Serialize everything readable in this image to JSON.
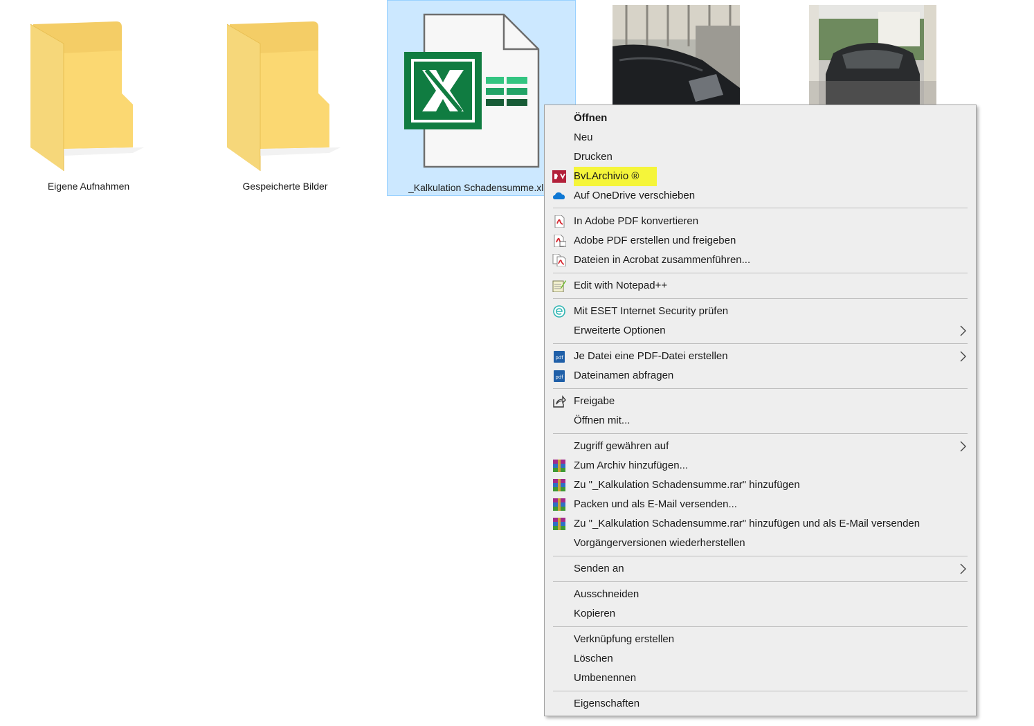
{
  "desktop": {
    "items": [
      {
        "label": "Eigene Aufnahmen"
      },
      {
        "label": "Gespeicherte Bilder"
      },
      {
        "label": "_Kalkulation Schadensumme.xlsx"
      }
    ]
  },
  "context_menu": {
    "items": [
      {
        "label": "Öffnen"
      },
      {
        "label": "Neu"
      },
      {
        "label": "Drucken"
      },
      {
        "label": "BvLArchivio ®"
      },
      {
        "label": "Auf OneDrive verschieben"
      },
      {
        "label": "In Adobe PDF konvertieren"
      },
      {
        "label": "Adobe PDF erstellen und freigeben"
      },
      {
        "label": "Dateien in Acrobat zusammenführen..."
      },
      {
        "label": "Edit with Notepad++"
      },
      {
        "label": "Mit ESET Internet Security prüfen"
      },
      {
        "label": "Erweiterte Optionen"
      },
      {
        "label": "Je Datei eine PDF-Datei erstellen"
      },
      {
        "label": "Dateinamen abfragen"
      },
      {
        "label": "Freigabe"
      },
      {
        "label": "Öffnen mit..."
      },
      {
        "label": "Zugriff gewähren auf"
      },
      {
        "label": "Zum Archiv hinzufügen..."
      },
      {
        "label": "Zu \"_Kalkulation Schadensumme.rar\" hinzufügen"
      },
      {
        "label": "Packen und als E-Mail versenden..."
      },
      {
        "label": "Zu \"_Kalkulation Schadensumme.rar\" hinzufügen und als E-Mail versenden"
      },
      {
        "label": "Vorgängerversionen wiederherstellen"
      },
      {
        "label": "Senden an"
      },
      {
        "label": "Ausschneiden"
      },
      {
        "label": "Kopieren"
      },
      {
        "label": "Verknüpfung erstellen"
      },
      {
        "label": "Löschen"
      },
      {
        "label": "Umbenennen"
      },
      {
        "label": "Eigenschaften"
      }
    ]
  },
  "colors": {
    "selection_bg": "#cce8ff",
    "menu_bg": "#eeeeee",
    "highlight": "#f5f53a",
    "excel_green": "#107c41"
  }
}
